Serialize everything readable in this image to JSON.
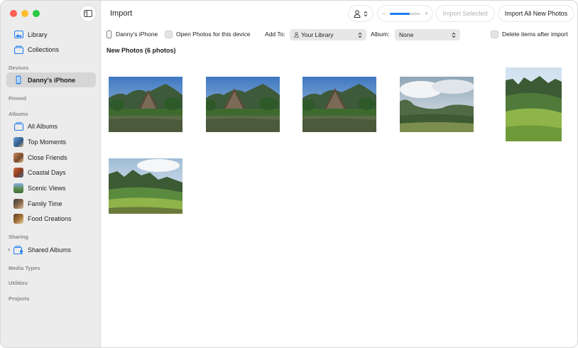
{
  "window": {
    "title": "Import"
  },
  "sidebar": {
    "items_top": [
      {
        "label": "Library",
        "icon": "photo-library-icon"
      },
      {
        "label": "Collections",
        "icon": "collections-icon"
      }
    ],
    "section_devices": "Devices",
    "device": {
      "label": "Danny's iPhone",
      "icon": "iphone-icon"
    },
    "section_pinned": "Pinned",
    "section_albums": "Albums",
    "albums": [
      {
        "label": "All Albums",
        "icon": "albums-icon"
      },
      {
        "label": "Top Moments",
        "icon": "album-thumb-icon"
      },
      {
        "label": "Close Friends",
        "icon": "album-thumb-icon"
      },
      {
        "label": "Coastal Days",
        "icon": "album-thumb-icon"
      },
      {
        "label": "Scenic Views",
        "icon": "album-thumb-icon"
      },
      {
        "label": "Family Time",
        "icon": "album-thumb-icon"
      },
      {
        "label": "Food Creations",
        "icon": "album-thumb-icon"
      }
    ],
    "section_sharing": "Sharing",
    "shared": {
      "label": "Shared Albums",
      "icon": "shared-albums-icon"
    },
    "section_media_types": "Media Types",
    "section_utilities": "Utilities",
    "section_projects": "Projects"
  },
  "toolbar": {
    "import_selected_label": "Import Selected",
    "import_all_label": "Import All New Photos",
    "zoom_minus": "−",
    "zoom_plus": "+",
    "zoom_level": 0.65
  },
  "options": {
    "device_name": "Danny's iPhone",
    "open_photos_label": "Open Photos for this device",
    "add_to_label": "Add To:",
    "add_to_value": "Your Library",
    "album_label": "Album:",
    "album_value": "None",
    "delete_after_label": "Delete items after import"
  },
  "content": {
    "section_title": "New Photos (6 photos)",
    "photos": [
      {
        "name": "photo-1",
        "scene": "a-frame-house"
      },
      {
        "name": "photo-2",
        "scene": "a-frame-house"
      },
      {
        "name": "photo-3",
        "scene": "a-frame-house"
      },
      {
        "name": "photo-4",
        "scene": "cloudy-valley"
      },
      {
        "name": "photo-5",
        "scene": "green-ridge"
      },
      {
        "name": "photo-6",
        "scene": "green-ridge"
      }
    ]
  },
  "colors": {
    "sidebar_bg": "#ececec",
    "selected_bg": "#d6d6d6",
    "accent": "#1e7cf2"
  }
}
